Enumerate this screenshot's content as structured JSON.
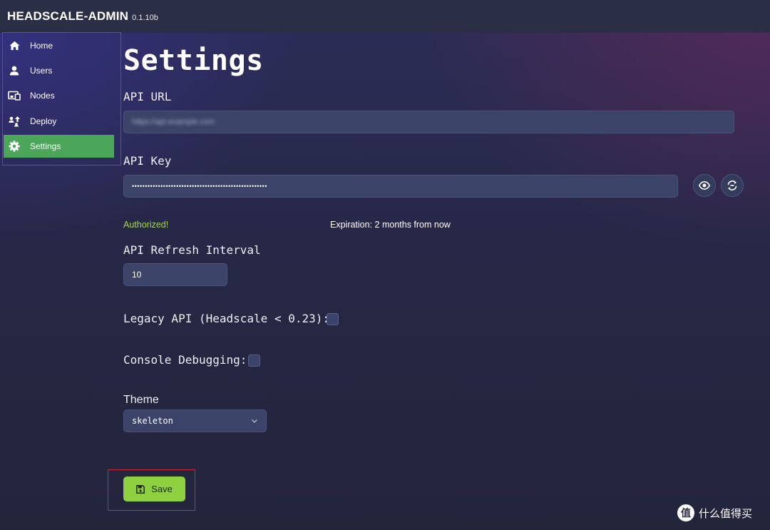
{
  "app": {
    "name": "HEADSCALE-ADMIN",
    "version": "0.1.10b"
  },
  "sidebar": {
    "items": [
      {
        "label": "Home",
        "icon": "home-icon"
      },
      {
        "label": "Users",
        "icon": "user-icon"
      },
      {
        "label": "Nodes",
        "icon": "devices-icon"
      },
      {
        "label": "Deploy",
        "icon": "deploy-icon"
      },
      {
        "label": "Settings",
        "icon": "gear-icon",
        "active": true
      }
    ]
  },
  "settings": {
    "title": "Settings",
    "api_url": {
      "label": "API URL",
      "value": "https://api.example.com"
    },
    "api_key": {
      "label": "API Key",
      "value": "••••••••••••••••••••••••••••••••••••••••••••••••••••"
    },
    "auth_status": "Authorized!",
    "expiration": "Expiration: 2 months from now",
    "refresh_interval": {
      "label": "API Refresh Interval",
      "value": "10"
    },
    "legacy_api": {
      "label": "Legacy API (Headscale < 0.23):",
      "checked": false
    },
    "console_debugging": {
      "label": "Console Debugging:",
      "checked": false
    },
    "theme": {
      "label": "Theme",
      "value": "skeleton"
    },
    "save_label": "Save"
  },
  "watermark": {
    "text": "什么值得买",
    "logo": "值"
  },
  "colors": {
    "accent_active": "#4ca65a",
    "save_button": "#8ed03f",
    "status_ok": "#a6d64a",
    "annotation_box": "#d4263a"
  }
}
